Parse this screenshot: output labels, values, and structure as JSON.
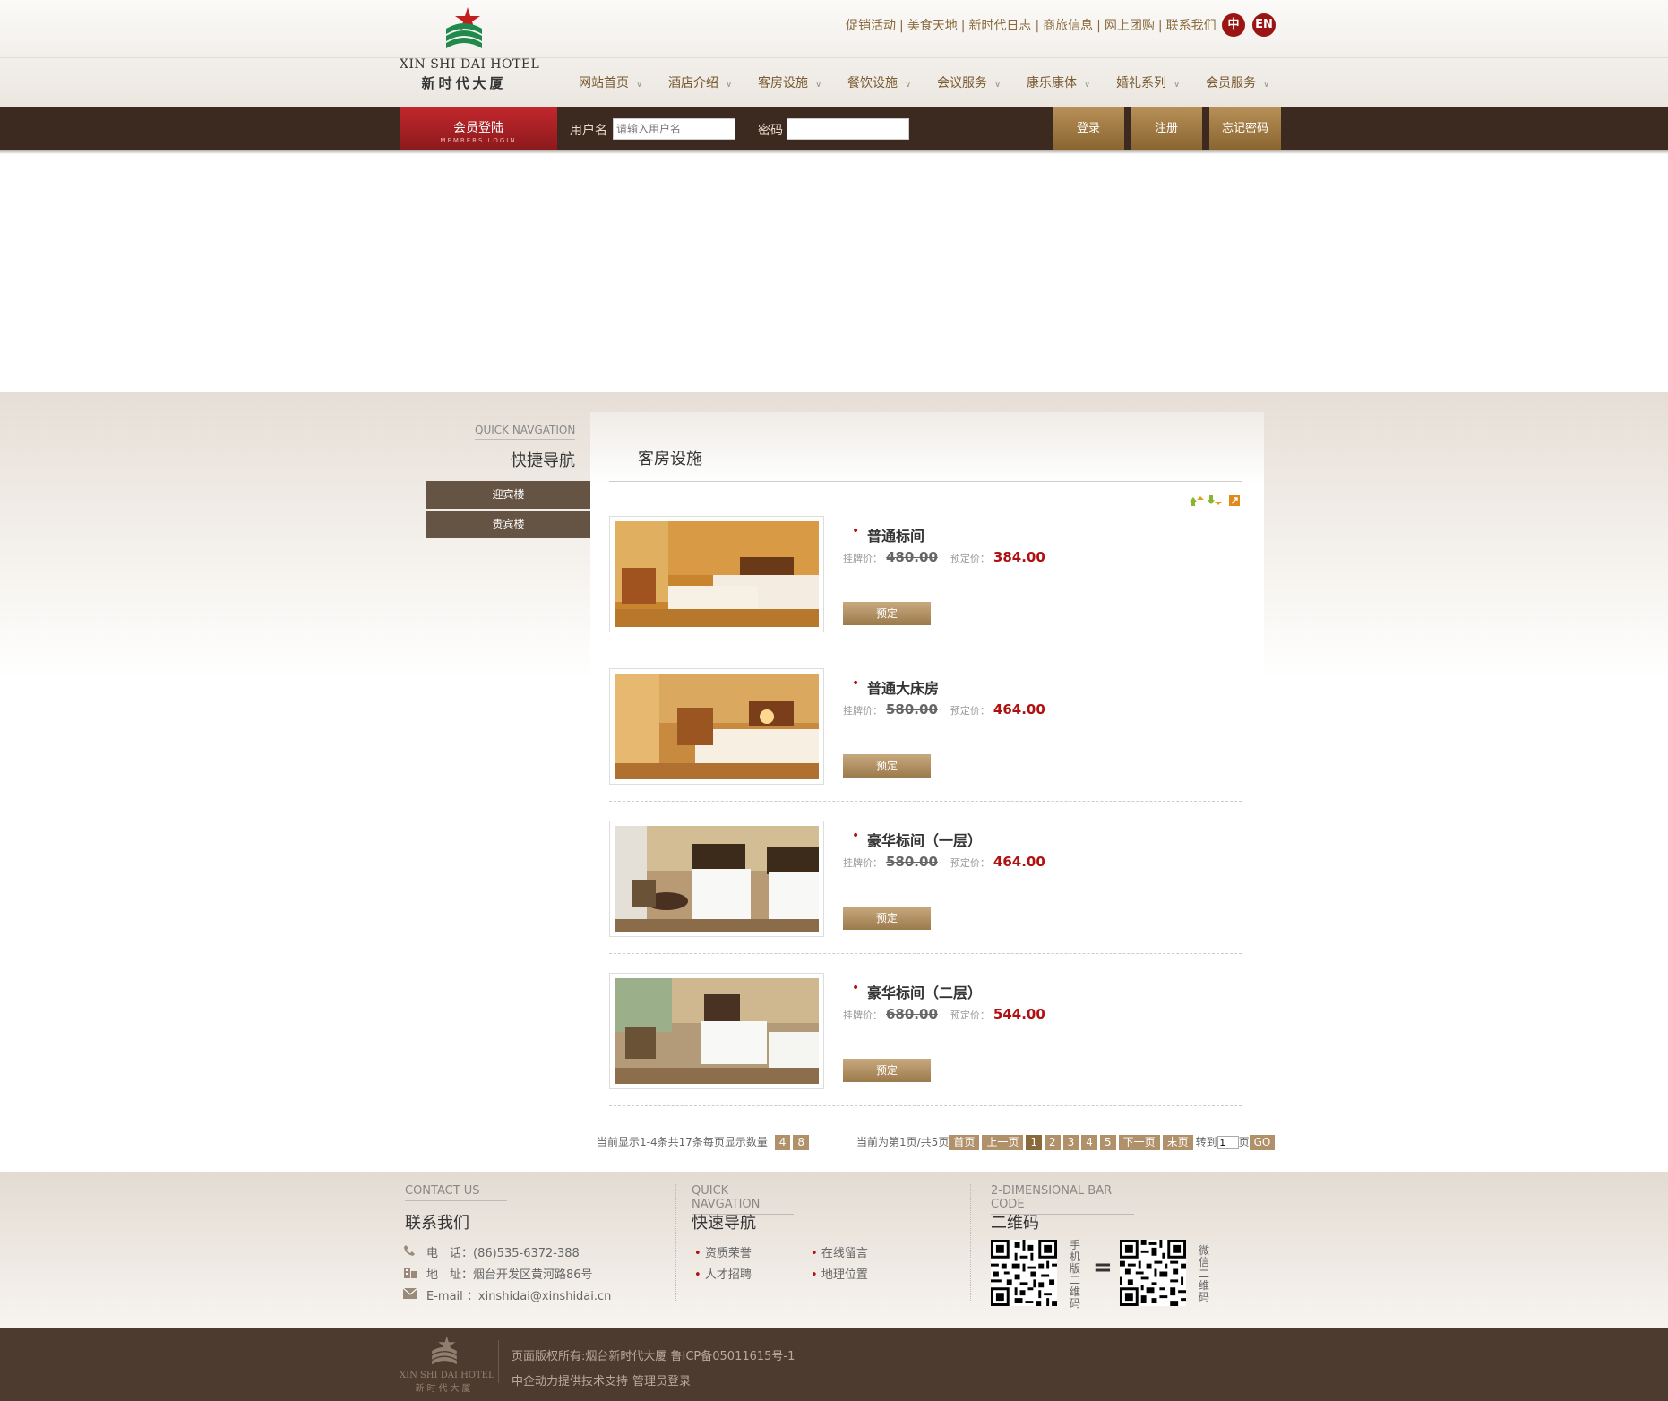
{
  "header": {
    "logo_en": "XIN SHI DAI HOTEL",
    "logo_cn": "新时代大厦",
    "top_links": [
      "促销活动",
      "美食天地",
      "新时代日志",
      "商旅信息",
      "网上团购",
      "联系我们"
    ],
    "lang_cn": "中",
    "lang_en": "EN",
    "nav": [
      "网站首页",
      "酒店介绍",
      "客房设施",
      "餐饮设施",
      "会议服务",
      "康乐康体",
      "婚礼系列",
      "会员服务"
    ]
  },
  "login": {
    "title": "会员登陆",
    "subtitle": "MEMBERS LOGIN",
    "username_label": "用户名",
    "username_placeholder": "请输入用户名",
    "password_label": "密码",
    "login_button": "登录",
    "register_button": "注册",
    "forgot_button": "忘记密码"
  },
  "sidebar": {
    "title_en": "QUICK NAVGATION",
    "title_cn": "快捷导航",
    "items": [
      "迎宾楼",
      "贵宾楼"
    ]
  },
  "main": {
    "title": "客房设施",
    "list_price_label": "挂牌价：",
    "book_price_label": "预定价：",
    "book_button": "预定",
    "rooms": [
      {
        "name": "普通标间",
        "list_price": "480.00",
        "book_price": "384.00"
      },
      {
        "name": "普通大床房",
        "list_price": "580.00",
        "book_price": "464.00"
      },
      {
        "name": "豪华标间（一层）",
        "list_price": "580.00",
        "book_price": "464.00"
      },
      {
        "name": "豪华标间（二层）",
        "list_price": "680.00",
        "book_price": "544.00"
      }
    ]
  },
  "pagination": {
    "summary": "当前显示1-4条共17条每页显示数量",
    "per_page_options": [
      "4",
      "8"
    ],
    "page_info": "当前为第1页/共5页",
    "first": "首页",
    "prev": "上一页",
    "pages": [
      "1",
      "2",
      "3",
      "4",
      "5"
    ],
    "next": "下一页",
    "last": "末页",
    "goto_label": "转到",
    "goto_value": "1",
    "page_suffix": "页",
    "go": "GO"
  },
  "footer": {
    "contact": {
      "title_en": "CONTACT US",
      "title_cn": "联系我们",
      "phone": "电　话：(86)535-6372-388",
      "address": "地　址：烟台开发区黄河路86号",
      "email": "E-mail ：xinshidai@xinshidai.cn"
    },
    "quick": {
      "title_en": "QUICK NAVGATION",
      "title_cn": "快速导航",
      "links": [
        "资质荣誉",
        "在线留言",
        "人才招聘",
        "地理位置"
      ]
    },
    "qrcode": {
      "title_en": "2-DIMENSIONAL BAR CODE",
      "title_cn": "二维码",
      "mobile_label": "手机版二维码",
      "wechat_label": "微信二维码",
      "equals": "="
    },
    "copyright": "页面版权所有:烟台新时代大厦 鲁ICP备05011615号-1",
    "support": "中企动力提供技术支持",
    "admin_login": "管理员登录"
  },
  "colors": {
    "brand_brown": "#3c2a20",
    "accent_gold": "#9b7a4c",
    "price_red": "#b01010",
    "member_red": "#a32024"
  }
}
